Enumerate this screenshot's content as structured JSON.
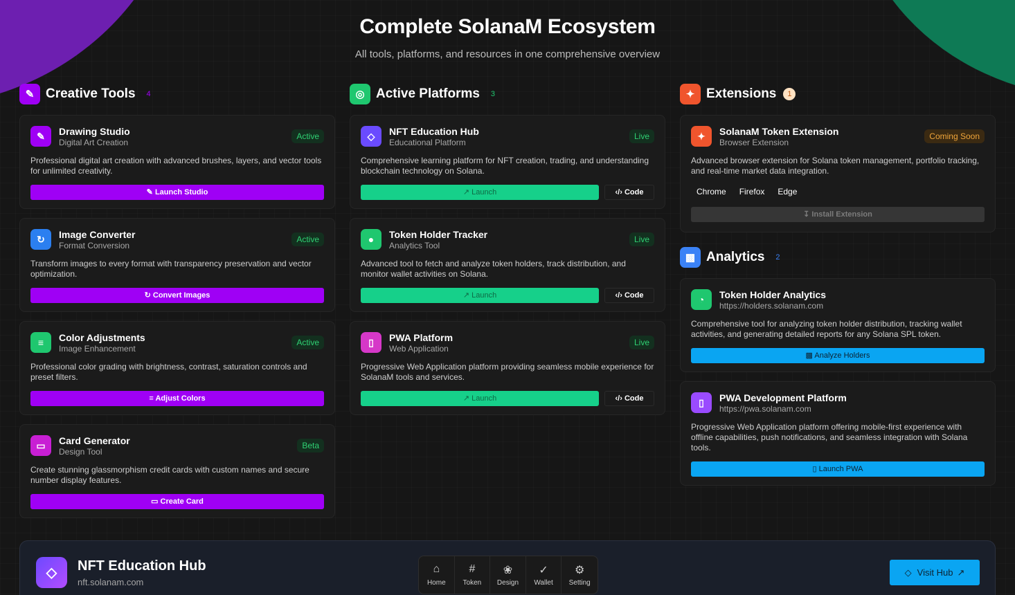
{
  "header": {
    "title": "Complete SolanaM Ecosystem",
    "subtitle": "All tools, platforms, and resources in one comprehensive overview"
  },
  "colors": {
    "purple": "#9f00f5",
    "green": "#16d08a",
    "blue": "#0aa5f2",
    "orange": "#f0552d"
  },
  "creative": {
    "title": "Creative Tools",
    "count": "4",
    "icon": "paintbrush-icon",
    "cards": [
      {
        "title": "Drawing Studio",
        "sub": "Digital Art Creation",
        "badge": "Active",
        "desc": "Professional digital art creation with advanced brushes, layers, and vector tools for unlimited creativity.",
        "button": "Launch Studio"
      },
      {
        "title": "Image Converter",
        "sub": "Format Conversion",
        "badge": "Active",
        "desc": "Transform images to every format with transparency preservation and vector optimization.",
        "button": "Convert Images"
      },
      {
        "title": "Color Adjustments",
        "sub": "Image Enhancement",
        "badge": "Active",
        "desc": "Professional color grading with brightness, contrast, saturation controls and preset filters.",
        "button": "Adjust Colors"
      },
      {
        "title": "Card Generator",
        "sub": "Design Tool",
        "badge": "Beta",
        "desc": "Create stunning glassmorphism credit cards with custom names and secure number display features.",
        "button": "Create Card"
      }
    ]
  },
  "platforms": {
    "title": "Active Platforms",
    "count": "3",
    "cards": [
      {
        "title": "NFT Education Hub",
        "sub": "Educational Platform",
        "badge": "Live",
        "desc": "Comprehensive learning platform for NFT creation, trading, and understanding blockchain technology on Solana.",
        "launch": "Launch",
        "code": "Code"
      },
      {
        "title": "Token Holder Tracker",
        "sub": "Analytics Tool",
        "badge": "Live",
        "desc": "Advanced tool to fetch and analyze token holders, track distribution, and monitor wallet activities on Solana.",
        "launch": "Launch",
        "code": "Code"
      },
      {
        "title": "PWA Platform",
        "sub": "Web Application",
        "badge": "Live",
        "desc": "Progressive Web Application platform providing seamless mobile experience for SolanaM tools and services.",
        "launch": "Launch",
        "code": "Code"
      }
    ]
  },
  "extensions": {
    "title": "Extensions",
    "count": "1",
    "card": {
      "title": "SolanaM Token Extension",
      "sub": "Browser Extension",
      "badge": "Coming Soon",
      "desc": "Advanced browser extension for Solana token management, portfolio tracking, and real-time market data integration.",
      "browsers": [
        "Chrome",
        "Firefox",
        "Edge"
      ],
      "button": "Install Extension"
    }
  },
  "analytics": {
    "title": "Analytics",
    "count": "2",
    "cards": [
      {
        "title": "Token Holder Analytics",
        "sub": "https://holders.solanam.com",
        "desc": "Comprehensive tool for analyzing token holder distribution, tracking wallet activities, and generating detailed reports for any Solana SPL token.",
        "button": "Analyze Holders"
      },
      {
        "title": "PWA Development Platform",
        "sub": "https://pwa.solanam.com",
        "desc": "Progressive Web Application platform offering mobile-first experience with offline capabilities, push notifications, and seamless integration with Solana tools.",
        "button": "Launch PWA"
      }
    ]
  },
  "footer": {
    "title": "NFT Education Hub",
    "url": "nft.solanam.com",
    "nav": [
      {
        "label": "Home",
        "icon": "home-icon"
      },
      {
        "label": "Token",
        "icon": "hash-icon"
      },
      {
        "label": "Design",
        "icon": "palette-icon"
      },
      {
        "label": "Wallet",
        "icon": "check-circle-icon"
      },
      {
        "label": "Setting",
        "icon": "gear-icon"
      }
    ],
    "visit": "Visit Hub"
  }
}
